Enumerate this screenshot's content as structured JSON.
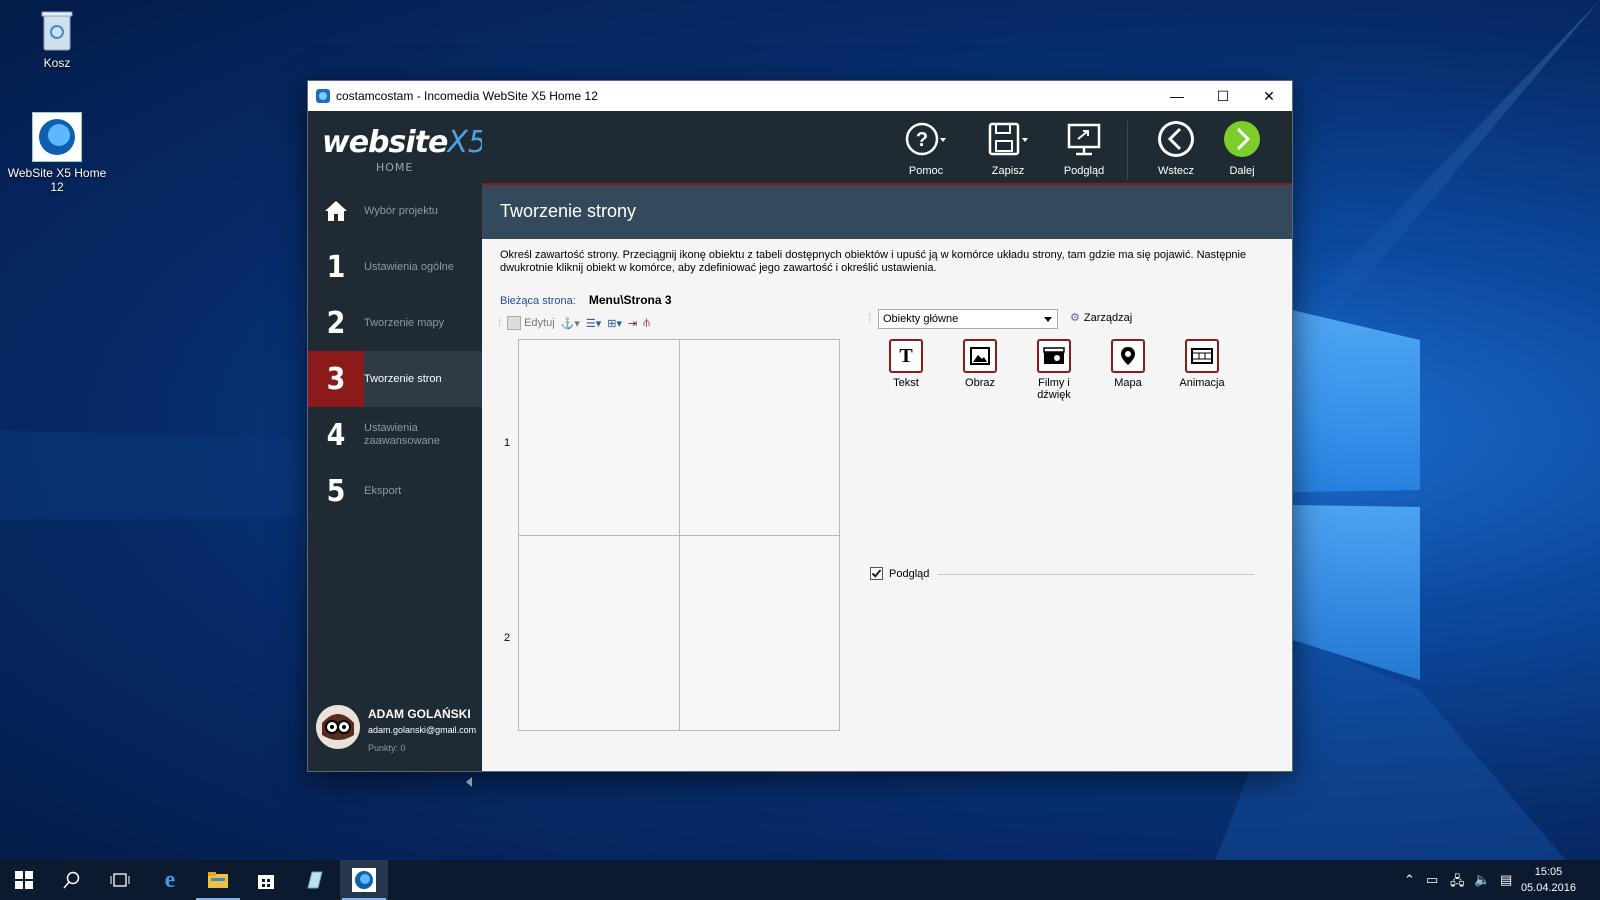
{
  "desktop": {
    "icons": [
      {
        "label": "Kosz"
      },
      {
        "label": "WebSite X5 Home 12"
      }
    ]
  },
  "window": {
    "title": "costamcostam - Incomedia WebSite X5 Home 12",
    "controls": {
      "minimize": "—",
      "maximize": "☐",
      "close": "✕"
    }
  },
  "logo": {
    "brand": "website",
    "x5": "X5",
    "edition": "HOME"
  },
  "sidebar": {
    "steps": [
      {
        "num": "",
        "label": "Wybór projektu"
      },
      {
        "num": "1",
        "label": "Ustawienia ogólne"
      },
      {
        "num": "2",
        "label": "Tworzenie mapy"
      },
      {
        "num": "3",
        "label": "Tworzenie stron",
        "active": true
      },
      {
        "num": "4",
        "label": "Ustawienia zaawansowane"
      },
      {
        "num": "5",
        "label": "Eksport"
      }
    ],
    "user": {
      "name": "ADAM GOLAŃSKI",
      "email": "adam.golanski@gmail.com",
      "points": "Punkty: 0"
    }
  },
  "toolbar": {
    "help": "Pomoc",
    "save": "Zapisz",
    "preview": "Podgląd",
    "back": "Wstecz",
    "next": "Dalej"
  },
  "main": {
    "title": "Tworzenie strony",
    "description": "Określ zawartość strony. Przeciągnij ikonę obiektu z tabeli dostępnych obiektów i upuść ją w komórce układu strony, tam gdzie ma się pojawić. Następnie dwukrotnie kliknij obiekt w komórce, aby zdefiniować jego zawartość i określić ustawienia.",
    "current_page_label": "Bieżąca strona:",
    "current_page_value": "Menu\\Strona 3",
    "edit_label": "Edytuj",
    "rows": [
      "1",
      "2"
    ],
    "objects_dropdown": "Obiekty główne",
    "manage_label": "Zarządzaj",
    "objects": [
      {
        "label": "Tekst"
      },
      {
        "label": "Obraz"
      },
      {
        "label": "Filmy i dźwięk"
      },
      {
        "label": "Mapa"
      },
      {
        "label": "Animacja"
      }
    ],
    "preview_checkbox": "Podgląd"
  },
  "taskbar": {
    "time": "15:05",
    "date": "05.04.2016"
  }
}
